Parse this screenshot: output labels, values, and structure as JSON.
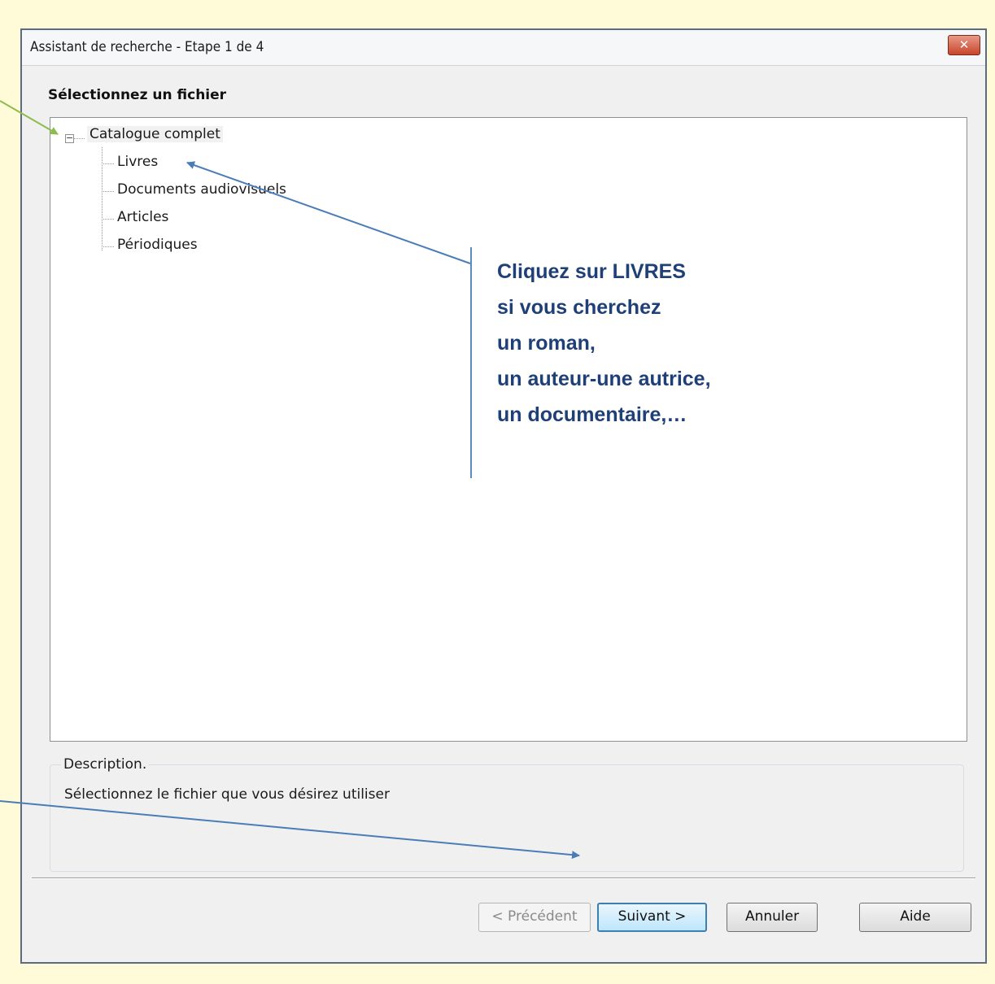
{
  "window": {
    "title": "Assistant de recherche - Etape 1 de 4",
    "close_label": "✕"
  },
  "heading": "Sélectionnez un fichier",
  "tree": {
    "root": {
      "label": "Catalogue complet",
      "expander": "−"
    },
    "children": [
      "Livres",
      "Documents audiovisuels",
      "Articles",
      "Périodiques"
    ]
  },
  "description": {
    "legend": "Description.",
    "text": "Sélectionnez le fichier que vous désirez utiliser"
  },
  "buttons": {
    "previous": "< Précédent",
    "next": "Suivant >",
    "cancel": "Annuler",
    "help": "Aide"
  },
  "annotation": {
    "lines": [
      "Cliquez sur LIVRES",
      "si vous cherchez",
      "un roman,",
      "un auteur-une autrice,",
      "un documentaire,…"
    ]
  },
  "colors": {
    "arrow_blue": "#4a7db8",
    "arrow_green": "#8cbd4a",
    "annotation_text": "#1f3f77"
  }
}
